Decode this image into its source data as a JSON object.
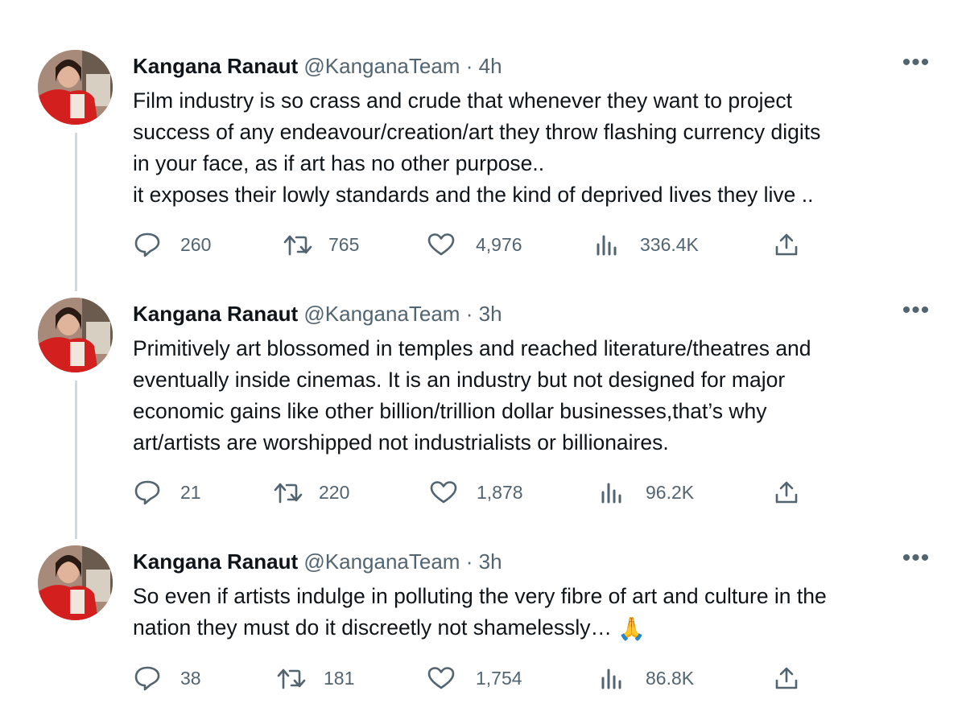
{
  "tweets": [
    {
      "author": "Kangana Ranaut",
      "handle": "@KanganaTeam",
      "separator": "·",
      "time": "4h",
      "more": "•••",
      "lines": [
        "Film industry is so crass and crude that whenever they want to project",
        "success of any endeavour/creation/art they throw flashing currency digits",
        "in your face, as if art has no other purpose..",
        "it exposes their lowly standards and the kind of deprived lives they live .."
      ],
      "emoji": "",
      "replies": "260",
      "retweets": "765",
      "likes": "4,976",
      "views": "336.4K"
    },
    {
      "author": "Kangana Ranaut",
      "handle": "@KanganaTeam",
      "separator": "·",
      "time": "3h",
      "more": "•••",
      "lines": [
        "Primitively art blossomed in temples and reached literature/theatres and",
        "eventually inside cinemas. It is an industry but not designed for major",
        "economic gains like other billion/trillion dollar businesses,that’s why",
        "art/artists are worshipped not industrialists or billionaires."
      ],
      "emoji": "",
      "replies": "21",
      "retweets": "220",
      "likes": "1,878",
      "views": "96.2K"
    },
    {
      "author": "Kangana Ranaut",
      "handle": "@KanganaTeam",
      "separator": "·",
      "time": "3h",
      "more": "•••",
      "lines": [
        "So even if artists indulge in polluting the very fibre of art and culture in the",
        "nation they must do it discreetly not shamelessly…"
      ],
      "emoji": "🙏",
      "replies": "38",
      "retweets": "181",
      "likes": "1,754",
      "views": "86.8K"
    }
  ],
  "icons": {
    "reply": "reply-icon",
    "retweet": "retweet-icon",
    "like": "heart-icon",
    "views": "views-bar-chart-icon",
    "share": "share-icon",
    "more": "more-options-icon"
  },
  "colors": {
    "text": "#0f1419",
    "secondary": "#536471",
    "thread_line": "#cfd9de"
  }
}
